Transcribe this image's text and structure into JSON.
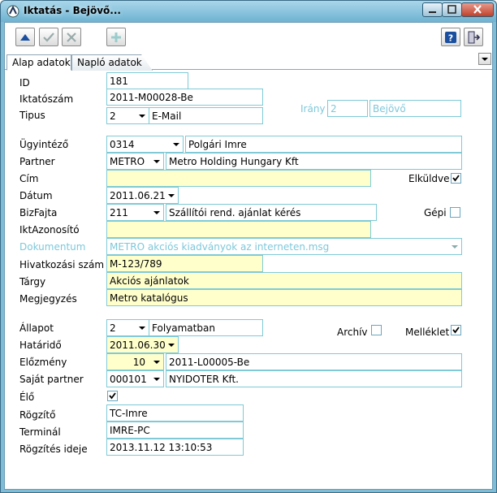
{
  "window": {
    "title": "Iktatás - Bejövő..."
  },
  "toolbar": {
    "up_icon": "arrow-up-icon",
    "ok_icon": "checkmark-icon",
    "cancel_icon": "cross-icon",
    "add_icon": "plus-icon",
    "help_icon": "help-icon",
    "exit_icon": "exit-door-icon"
  },
  "tabs": [
    {
      "label": "Alap adatok",
      "active": true
    },
    {
      "label": "Napló adatok",
      "active": false
    }
  ],
  "form": {
    "id": {
      "label": "ID",
      "value": "181"
    },
    "iktatoszam": {
      "label": "Iktatószám",
      "value": "2011-M00028-Be"
    },
    "tipus": {
      "label": "Tipus",
      "code": "2",
      "text": "E-Mail"
    },
    "irany": {
      "label": "Irány",
      "code": "2",
      "text": "Bejövő"
    },
    "ugyintezo": {
      "label": "Ügyintéző",
      "code": "0314",
      "text": "Polgári Imre"
    },
    "partner": {
      "label": "Partner",
      "code": "METRO",
      "text": "Metro Holding Hungary Kft"
    },
    "cim": {
      "label": "Cím",
      "value": ""
    },
    "elkuldve": {
      "label": "Elküldve",
      "checked": true
    },
    "datum": {
      "label": "Dátum",
      "value": "2011.06.21"
    },
    "bizfajta": {
      "label": "BizFajta",
      "code": "211",
      "text": "Szállítói rend. ajánlat kérés"
    },
    "gepi": {
      "label": "Gépi",
      "checked": false
    },
    "iktazonosito": {
      "label": "IktAzonosító",
      "value": ""
    },
    "dokumentum": {
      "label": "Dokumentum",
      "value": "METRO akciós kiadványok az interneten.msg"
    },
    "hivatkozasi": {
      "label": "Hivatkozási szám",
      "value": "M-123/789"
    },
    "targy": {
      "label": "Tárgy",
      "value": "Akciós ajánlatok"
    },
    "megjegyzes": {
      "label": "Megjegyzés",
      "value": "Metro katalógus"
    },
    "allapot": {
      "label": "Állapot",
      "code": "2",
      "text": "Folyamatban"
    },
    "archiv": {
      "label": "Archív",
      "checked": false
    },
    "melleklet": {
      "label": "Melléklet",
      "checked": true
    },
    "hatarido": {
      "label": "Határidő",
      "value": "2011.06.30"
    },
    "elozmeny": {
      "label": "Előzmény",
      "code": "10",
      "text": "2011-L00005-Be"
    },
    "sajat_partner": {
      "label": "Saját partner",
      "code": "000101",
      "text": "NYIDOTER Kft."
    },
    "elo": {
      "label": "Élő",
      "checked": true
    },
    "rogzito": {
      "label": "Rögzítő",
      "value": "TC-Imre"
    },
    "terminal": {
      "label": "Terminál",
      "value": "IMRE-PC"
    },
    "rogzites_ideje": {
      "label": "Rögzítés ideje",
      "value": "2013.11.12 13:10:53"
    }
  }
}
